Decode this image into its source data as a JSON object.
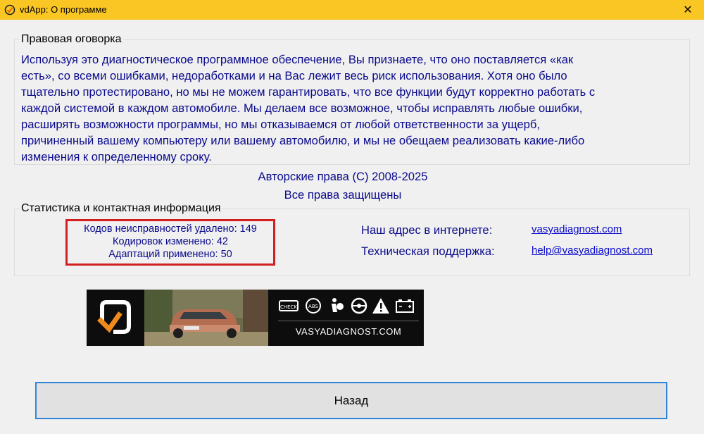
{
  "titlebar": {
    "title": "vdApp:  О программе",
    "close_glyph": "✕",
    "accent": "#f9c624"
  },
  "legal": {
    "heading": "Правовая оговорка",
    "lines": [
      "Используя это диагностическое программное обеспечение, Вы признаете, что оно поставляется «как",
      "есть», со всеми ошибками, недоработками и на Вас лежит весь риск использования. Хотя оно было",
      "тщательно протестировано, но мы не можем гарантировать, что все функции будут корректно работать с",
      "каждой системой в каждом автомобиле. Мы делаем все возможное, чтобы исправлять любые ошибки,",
      "расширять возможности программы, но мы отказываемся от любой ответственности за ущерб,",
      "причиненный  вашему компьютеру или вашему автомобилю, и мы не обещаем реализовать какие-либо",
      "изменения к определенному сроку."
    ]
  },
  "copyright": {
    "line1": "Авторские права (С) 2008-2025",
    "line2": "Все права защищены"
  },
  "stats": {
    "heading": "Статистика и контактная информация",
    "dtc_removed": "Кодов неисправностей удалено: 149",
    "codings_changed": "Кодировок изменено: 42",
    "adaptations_applied": "Адаптаций применено: 50",
    "highlight_color": "#d22020"
  },
  "contacts": {
    "website_label": "Наш адрес в интернете:",
    "website": "vasyadiagnost.com",
    "support_label": "Техническая поддержка:",
    "support_email": "help@vasyadiagnost.com"
  },
  "banner": {
    "brand_text": "VASYADIAGNOST.COM",
    "icons": [
      "check-engine-icon",
      "abs-icon",
      "airbag-icon",
      "steering-wheel-icon",
      "warning-triangle-icon",
      "battery-icon"
    ]
  },
  "footer": {
    "back_label": "Назад"
  }
}
